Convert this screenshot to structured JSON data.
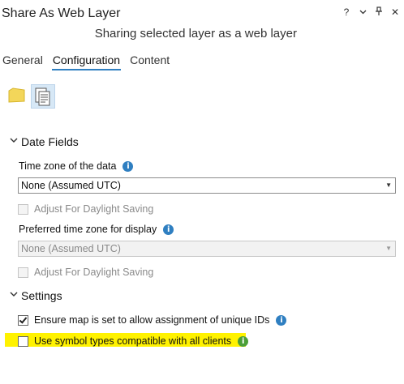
{
  "window": {
    "title": "Share As Web Layer",
    "controls": {
      "help": "?",
      "menu": "⌄",
      "pin": "📌",
      "close": "✕"
    }
  },
  "subtitle": "Sharing selected layer as a web layer",
  "tabs": [
    {
      "label": "General",
      "active": false
    },
    {
      "label": "Configuration",
      "active": true
    },
    {
      "label": "Content",
      "active": false
    }
  ],
  "toolbar": {
    "items": [
      {
        "icon": "layer-icon",
        "selected": false
      },
      {
        "icon": "configure-properties-icon",
        "selected": true
      }
    ]
  },
  "date_fields": {
    "header": "Date Fields",
    "time_zone_label": "Time zone of the data",
    "time_zone_value": "None (Assumed UTC)",
    "adjust_dst_1": "Adjust For Daylight Saving",
    "preferred_tz_label": "Preferred time zone for display",
    "preferred_tz_value": "None (Assumed UTC)",
    "adjust_dst_2": "Adjust For Daylight Saving"
  },
  "settings": {
    "header": "Settings",
    "unique_ids_label": "Ensure map is set to allow assignment of unique IDs",
    "unique_ids_checked": true,
    "symbol_types_label": "Use symbol types compatible with all clients",
    "symbol_types_checked": false,
    "highlight_color": "#fff200"
  },
  "colors": {
    "accent": "#2f7fc1",
    "info_green": "#4b9f38"
  }
}
